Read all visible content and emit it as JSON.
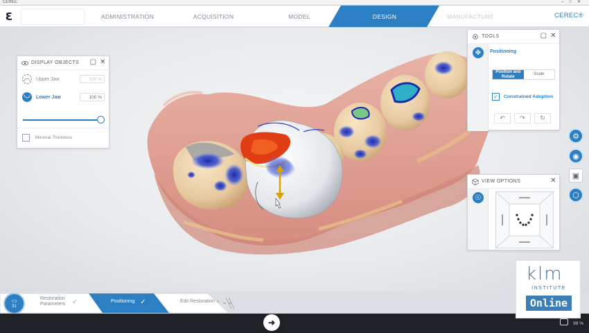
{
  "window": {
    "title": "CEREC"
  },
  "workflow": {
    "steps": [
      {
        "label": "ADMINISTRATION",
        "state": "done"
      },
      {
        "label": "ACQUISITION",
        "state": "done"
      },
      {
        "label": "MODEL",
        "state": "done"
      },
      {
        "label": "DESIGN",
        "state": "active"
      },
      {
        "label": "MANUFACTURE",
        "state": "disabled"
      }
    ],
    "brand": "CEREC®"
  },
  "display_objects": {
    "title": "DISPLAY OBJECTS",
    "items": [
      {
        "label": "Upper Jaw",
        "value": "100 %",
        "active": false
      },
      {
        "label": "Lower Jaw",
        "value": "100 %",
        "active": true
      }
    ],
    "opacity_level": 1.0,
    "minimal_thickness_label": "Minimal Thickness",
    "minimal_thickness_checked": false
  },
  "tools": {
    "title": "TOOLS",
    "mode_label": "Positioning",
    "segments": [
      {
        "label": "Position and Rotate",
        "selected": true
      },
      {
        "label": "Scale",
        "selected": false
      }
    ],
    "constrained_adoption_label": "Constrained Adoption",
    "constrained_adoption_checked": true
  },
  "view_options": {
    "title": "VIEW OPTIONS"
  },
  "bottom_steps": {
    "badge_number": "31",
    "steps": [
      {
        "label": "Restoration Parameters",
        "state": "done"
      },
      {
        "label": "Positioning",
        "state": "active"
      },
      {
        "label": "Edit Restoration",
        "state": "next"
      }
    ]
  },
  "logo": {
    "letters": "klm",
    "subtitle": "INSTITUTE",
    "tag": "Online"
  },
  "tray": {
    "battery": "98 %"
  },
  "colors": {
    "accent": "#2d7fc4",
    "gum": "#e3a79c",
    "tooth": "#eed7b3",
    "contact_high": "#e34b1e",
    "contact_blue": "#2a3fc4"
  }
}
